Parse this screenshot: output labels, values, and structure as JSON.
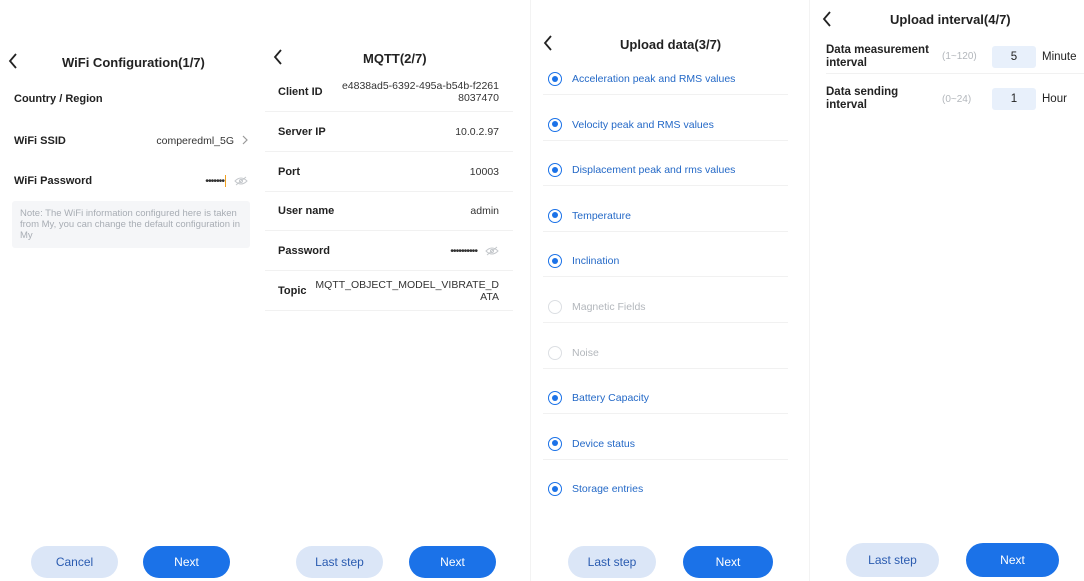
{
  "wifi": {
    "title": "WiFi Configuration(1/7)",
    "country_label": "Country / Region",
    "country_value": "",
    "ssid_label": "WiFi SSID",
    "ssid_value": "comperedml_5G",
    "password_label": "WiFi Password",
    "password_value": "•••••••",
    "note": "Note: The WiFi information configured here is taken from My, you can change the default configuration in My",
    "cancel_label": "Cancel",
    "next_label": "Next"
  },
  "mqtt": {
    "title": "MQTT(2/7)",
    "client_id_label": "Client ID",
    "client_id_value": "e4838ad5-6392-495a-b54b-f22618037470",
    "server_ip_label": "Server IP",
    "server_ip_value": "10.0.2.97",
    "port_label": "Port",
    "port_value": "10003",
    "username_label": "User name",
    "username_value": "admin",
    "password_label": "Password",
    "password_value": "••••••••••",
    "topic_label": "Topic",
    "topic_value": "MQTT_OBJECT_MODEL_VIBRATE_DATA",
    "last_label": "Last step",
    "next_label": "Next"
  },
  "upload": {
    "title": "Upload data(3/7)",
    "items": [
      {
        "label": "Acceleration peak and RMS values",
        "checked": true
      },
      {
        "label": "Velocity peak and RMS values",
        "checked": true
      },
      {
        "label": "Displacement peak and rms values",
        "checked": true
      },
      {
        "label": "Temperature",
        "checked": true
      },
      {
        "label": "Inclination",
        "checked": true
      },
      {
        "label": "Magnetic Fields",
        "checked": false
      },
      {
        "label": "Noise",
        "checked": false
      },
      {
        "label": "Battery Capacity",
        "checked": true
      },
      {
        "label": "Device status",
        "checked": true
      },
      {
        "label": "Storage entries",
        "checked": true
      }
    ],
    "last_label": "Last step",
    "next_label": "Next"
  },
  "interval": {
    "title": "Upload interval(4/7)",
    "measure_label": "Data measurement interval",
    "measure_range": "(1~120)",
    "measure_value": "5",
    "measure_unit": "Minute",
    "send_label": "Data sending interval",
    "send_range": "(0~24)",
    "send_value": "1",
    "send_unit": "Hour",
    "last_label": "Last step",
    "next_label": "Next"
  },
  "colors": {
    "primary": "#1b72e8",
    "primary_light": "#dbe6f7",
    "checked_text": "#2469c7",
    "disabled_text": "#b3b7bc"
  }
}
